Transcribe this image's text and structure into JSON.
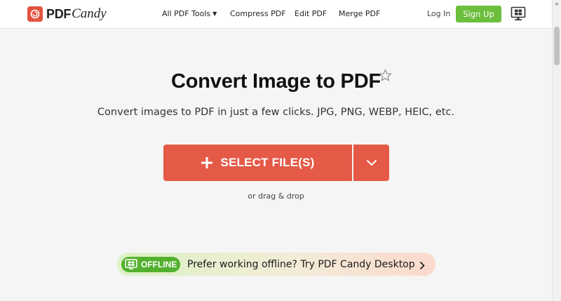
{
  "header": {
    "logo": {
      "text_bold": "PDF",
      "text_italic": "Candy",
      "icon": "candy-logo-icon"
    },
    "nav": {
      "all_tools": "All PDF Tools",
      "compress": "Compress PDF",
      "edit": "Edit PDF",
      "merge": "Merge PDF",
      "login": "Log In",
      "signup": "Sign Up"
    },
    "desktop_icon": "windows-monitor-icon"
  },
  "main": {
    "title": "Convert Image to PDF",
    "favorite_icon": "star-icon",
    "subtitle": "Convert images to PDF in just a few clicks. JPG, PNG, WEBP, HEIC, etc.",
    "select_button": "SELECT FILE(S)",
    "dropdown_icon": "chevron-down-icon",
    "drag_hint": "or drag & drop"
  },
  "offline": {
    "badge": "OFFLINE",
    "text": "Prefer working offline? Try PDF Candy Desktop"
  },
  "colors": {
    "accent": "#e55a47",
    "signup": "#6cbe3d",
    "offline_badge": "#53b02e"
  }
}
